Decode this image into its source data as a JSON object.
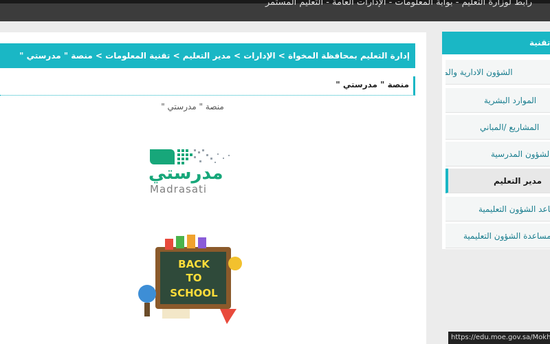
{
  "topbar": {
    "text": "رابط لوزارة التعليم - بوابة المعلومات - الإدارات العامة - التعليم المستمر"
  },
  "main": {
    "breadcrumb": "إدارة التعليم بمحافظة المخواة > الإدارات > مدير التعليم > تقنية المعلومات > منصة \" مدرستي \"",
    "heading": "منصة \" مدرستي \"",
    "subtitle": "منصة \" مدرستي \"",
    "logo": {
      "script": "مدرستي",
      "latin": "Madrasati",
      "color": "#17a77a"
    },
    "back_to_school": {
      "line1": "BACK",
      "line2": "TO",
      "line3": "SCHOOL"
    }
  },
  "sidebar": {
    "title": "تقنية المعلومات",
    "items": [
      {
        "label": "الشؤون الادارية والمالية",
        "active": false
      },
      {
        "label": "الموارد البشرية",
        "active": false
      },
      {
        "label": "المشاريع /المباني",
        "active": false
      },
      {
        "label": "الشؤون المدرسية",
        "active": false
      },
      {
        "label": "مدير التعليم",
        "active": true
      },
      {
        "label": "مساعد الشؤون التعليمية",
        "active": false
      },
      {
        "label": "مساعدة الشؤون التعليمية",
        "active": false
      }
    ]
  },
  "status": {
    "url": "https://edu.moe.gov.sa/Mokhwah/"
  },
  "colors": {
    "accent": "#1ab7c5",
    "topbar": "#3c3c3c"
  }
}
